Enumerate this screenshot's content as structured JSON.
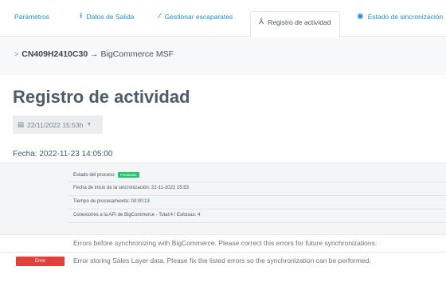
{
  "tabs": [
    {
      "label": "Parámetros",
      "icon": "",
      "active": false
    },
    {
      "label": "Datos de Salida",
      "icon": "upload-icon",
      "active": false
    },
    {
      "label": "Gestionar escaparates",
      "icon": "magic-wand-icon",
      "active": false
    },
    {
      "label": "Registro de actividad",
      "icon": "activity-icon",
      "active": true
    },
    {
      "label": "Estado de sincronización",
      "icon": "eye-icon",
      "active": false
    }
  ],
  "breadcrumb": {
    "code": "CN409H2410C30",
    "arrow": "→",
    "target": "BigCommerce MSF"
  },
  "page_title": "Registro de actividad",
  "date_select": {
    "value": "22/11/2022 15:53h",
    "icon": "calendar-icon"
  },
  "fecha": "Fecha: 2022-11-23 14:05:00",
  "info": {
    "estado_label": "Estado del proceso:",
    "estado_badge": "Finalizado",
    "inicio": "Fecha de inicio de la sincronización: 22-11-2022 15:53",
    "tiempo": "Tiempo de procesamiento: 00:00:13",
    "conexiones": "Conexiones a la API de BigCommerce - Total:4 / Exitosas: 4"
  },
  "messages": [
    {
      "badge": "",
      "text": "Errors before synchronizing with BigCommerce. Please correct this errors for future synchronizations:"
    },
    {
      "badge": "Error",
      "text": "Error storing Sales Layer data. Please fix the listed errors so the synchronization can be performed."
    }
  ],
  "colors": {
    "tab_link": "#1f8ed1",
    "title": "#4d5b6a",
    "success": "#25c26a",
    "error": "#e0413c"
  }
}
